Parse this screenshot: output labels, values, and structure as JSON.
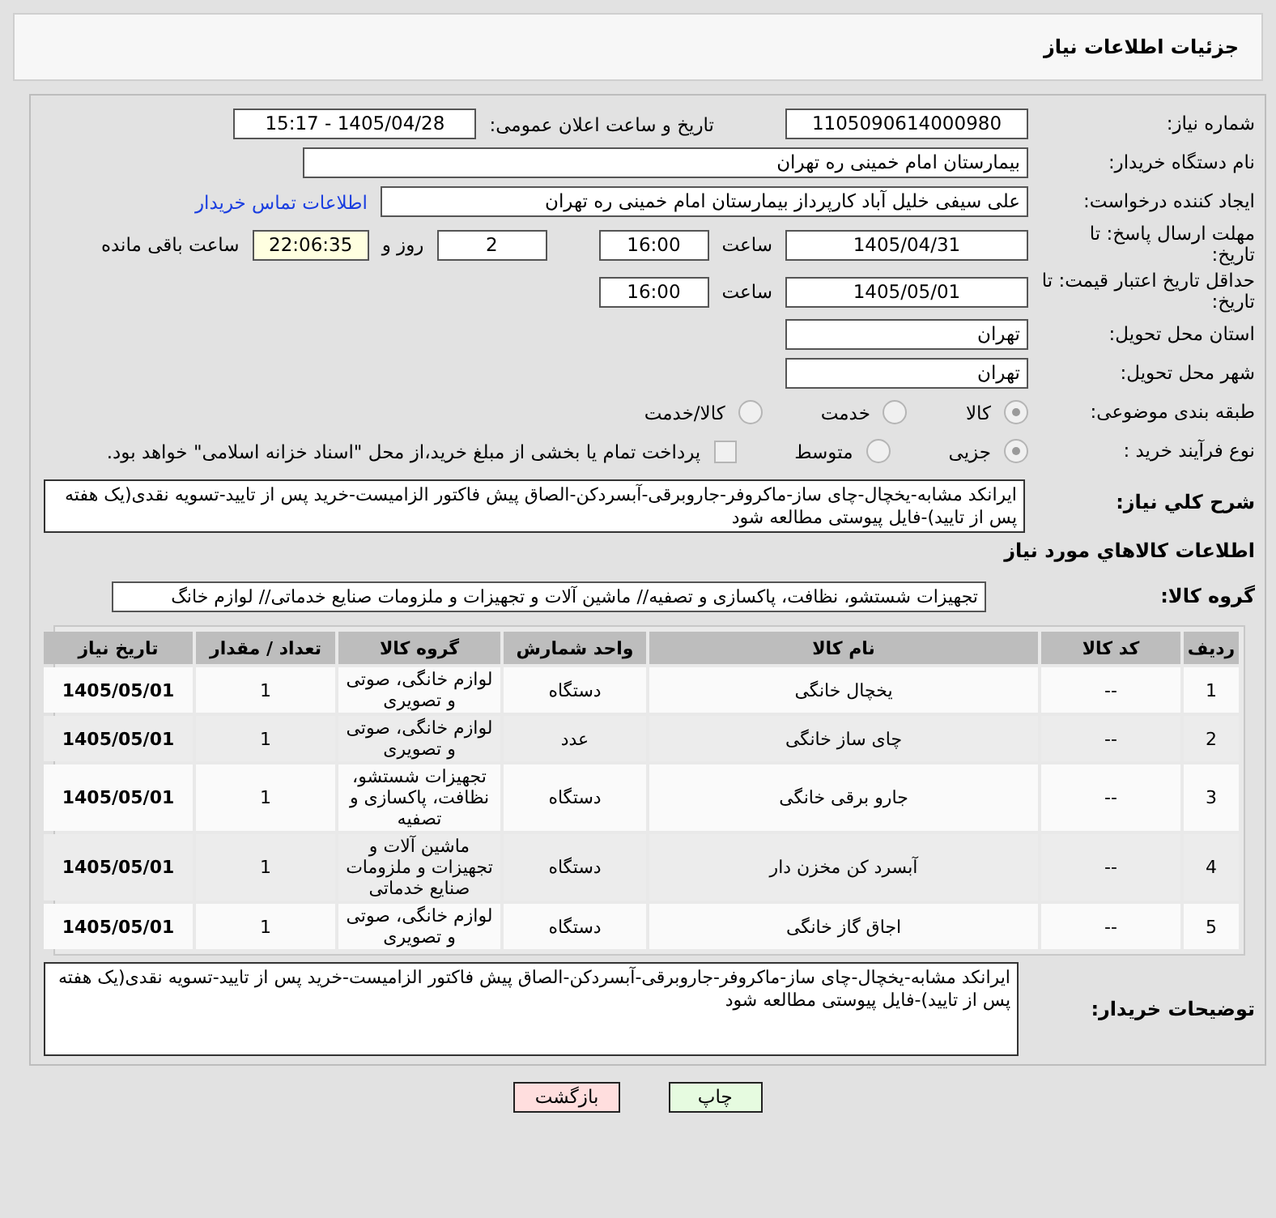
{
  "header": {
    "title": "جزئیات اطلاعات نیاز"
  },
  "need_number": {
    "label": "شماره نیاز:",
    "value": "1105090614000980"
  },
  "announce": {
    "label": "تاریخ و ساعت اعلان عمومی:",
    "value": "1405/04/28 - 15:17"
  },
  "buyer_org": {
    "label": "نام دستگاه خریدار:",
    "value": "بیمارستان امام خمینی ره  تهران"
  },
  "creator": {
    "label": "ایجاد کننده درخواست:",
    "value": "علی سیفی خلیل آباد کارپرداز بیمارستان امام خمینی ره  تهران",
    "link": "اطلاعات تماس خریدار"
  },
  "reply_deadline": {
    "label": "مهلت ارسال پاسخ: تا تاریخ:",
    "date": "1405/04/31",
    "time_label": "ساعت",
    "time": "16:00",
    "days": "2",
    "days_label": "روز و",
    "remaining": "22:06:35",
    "remaining_label": "ساعت باقی مانده"
  },
  "price_validity": {
    "label": "حداقل تاریخ اعتبار قیمت: تا تاریخ:",
    "date": "1405/05/01",
    "time_label": "ساعت",
    "time": "16:00"
  },
  "province": {
    "label": "استان محل تحویل:",
    "value": "تهران"
  },
  "city": {
    "label": "شهر محل تحویل:",
    "value": "تهران"
  },
  "category": {
    "label": "طبقه بندی موضوعی:",
    "options": [
      {
        "label": "کالا",
        "selected": true
      },
      {
        "label": "خدمت",
        "selected": false
      },
      {
        "label": "کالا/خدمت",
        "selected": false
      }
    ]
  },
  "purchase_type": {
    "label": "نوع فرآیند خرید :",
    "options": [
      {
        "label": "جزیی",
        "selected": true
      },
      {
        "label": "متوسط",
        "selected": false
      }
    ],
    "payment": {
      "label": "پرداخت تمام یا بخشی از مبلغ خرید،از محل \"اسناد خزانه اسلامی\" خواهد بود.",
      "checked": false
    }
  },
  "description": {
    "label": "شرح کلي نياز:",
    "value": "ایرانکد مشابه-یخچال-چای ساز-ماکروفر-جاروبرقی-آبسردکن-الصاق پیش فاکتور الزامیست-خرید پس از تایید-تسویه نقدی(یک هفته پس از تایید)-فایل پیوستی مطالعه شود"
  },
  "goods_heading": "اطلاعات کالاهاي مورد نياز",
  "goods_group": {
    "label": "گروه کالا:",
    "value": "تجهیزات شستشو، نظافت، پاکسازی و تصفیه// ماشین آلات و تجهیزات و ملزومات صنایع خدماتی// لوازم خانگ"
  },
  "table": {
    "columns": [
      "ردیف",
      "کد کالا",
      "نام کالا",
      "واحد شمارش",
      "گروه کالا",
      "تعداد / مقدار",
      "تاریخ نیاز"
    ],
    "rows": [
      [
        "1",
        "--",
        "یخچال خانگی",
        "دستگاه",
        "لوازم خانگی، صوتی و تصویری",
        "1",
        "1405/05/01"
      ],
      [
        "2",
        "--",
        "چای ساز خانگی",
        "عدد",
        "لوازم خانگی، صوتی و تصویری",
        "1",
        "1405/05/01"
      ],
      [
        "3",
        "--",
        "جارو برقی خانگی",
        "دستگاه",
        "تجهیزات شستشو، نظافت، پاکسازی و تصفیه",
        "1",
        "1405/05/01"
      ],
      [
        "4",
        "--",
        "آبسرد کن مخزن دار",
        "دستگاه",
        "ماشین آلات و تجهیزات و ملزومات صنایع خدماتی",
        "1",
        "1405/05/01"
      ],
      [
        "5",
        "--",
        "اجاق گاز خانگی",
        "دستگاه",
        "لوازم خانگی، صوتی و تصویری",
        "1",
        "1405/05/01"
      ]
    ]
  },
  "buyer_notes": {
    "label": "توضیحات خریدار:",
    "value": "ایرانکد مشابه-یخچال-چای ساز-ماکروفر-جاروبرقی-آبسردکن-الصاق پیش فاکتور الزامیست-خرید پس از تایید-تسویه نقدی(یک هفته پس از تایید)-فایل پیوستی  مطالعه شود"
  },
  "buttons": [
    {
      "label": "چاپ",
      "kind": "print"
    },
    {
      "label": "بازگشت",
      "kind": "back"
    }
  ]
}
